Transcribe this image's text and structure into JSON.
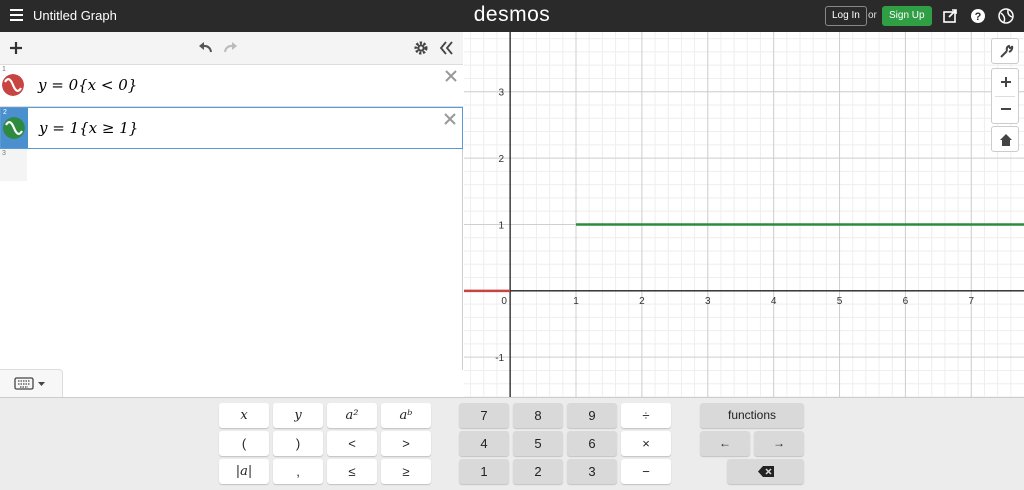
{
  "header": {
    "graph_title": "Untitled Graph",
    "logo": "desmos",
    "login_label": "Log In",
    "or_text": "or",
    "signup_label": "Sign Up",
    "bg_color": "#2a2a2a",
    "signup_color": "#2f9e44"
  },
  "expressions": [
    {
      "index": "1",
      "text": "y = 0{x < 0}",
      "color": "#c74440"
    },
    {
      "index": "2",
      "text": "y = 1{x ≥ 1}",
      "color": "#2d8a3e"
    },
    {
      "index": "3",
      "text": ""
    }
  ],
  "graph": {
    "x_ticks": [
      "0",
      "1",
      "2",
      "3",
      "4",
      "5",
      "6",
      "7"
    ],
    "y_ticks": [
      "3",
      "2",
      "1",
      "-1"
    ],
    "x_range": [
      -0.7,
      7.8
    ],
    "y_range": [
      -1.6,
      3.9
    ],
    "grid": true,
    "curves": [
      {
        "expression": "y = 0{x < 0}",
        "color": "#c74440",
        "y": 0,
        "x_from": -0.7,
        "x_to": 0
      },
      {
        "expression": "y = 1{x ≥ 1}",
        "color": "#2d8a3e",
        "y": 1,
        "x_from": 1,
        "x_to": 7.8
      }
    ]
  },
  "keypad": {
    "math_keys": [
      [
        "x",
        "y",
        "a²",
        "aᵇ"
      ],
      [
        "(",
        ")",
        "<",
        ">"
      ],
      [
        "|a|",
        ",",
        "≤",
        "≥"
      ]
    ],
    "num_keys": [
      [
        "7",
        "8",
        "9",
        "÷"
      ],
      [
        "4",
        "5",
        "6",
        "×"
      ],
      [
        "1",
        "2",
        "3",
        "−"
      ]
    ],
    "functions_label": "functions",
    "left_arrow": "←",
    "right_arrow": "→"
  },
  "icons": {
    "menu": "hamburger-icon",
    "share": "share-icon",
    "help": "help-icon",
    "language": "globe-icon",
    "add": "plus-icon",
    "undo": "undo-icon",
    "redo": "redo-icon",
    "settings": "gear-icon",
    "collapse": "double-chevron-left-icon",
    "wrench": "wrench-icon",
    "zoom_in": "zoom-in-icon",
    "zoom_out": "zoom-out-icon",
    "home": "home-icon",
    "keyboard": "keyboard-icon",
    "backspace": "backspace-icon"
  }
}
